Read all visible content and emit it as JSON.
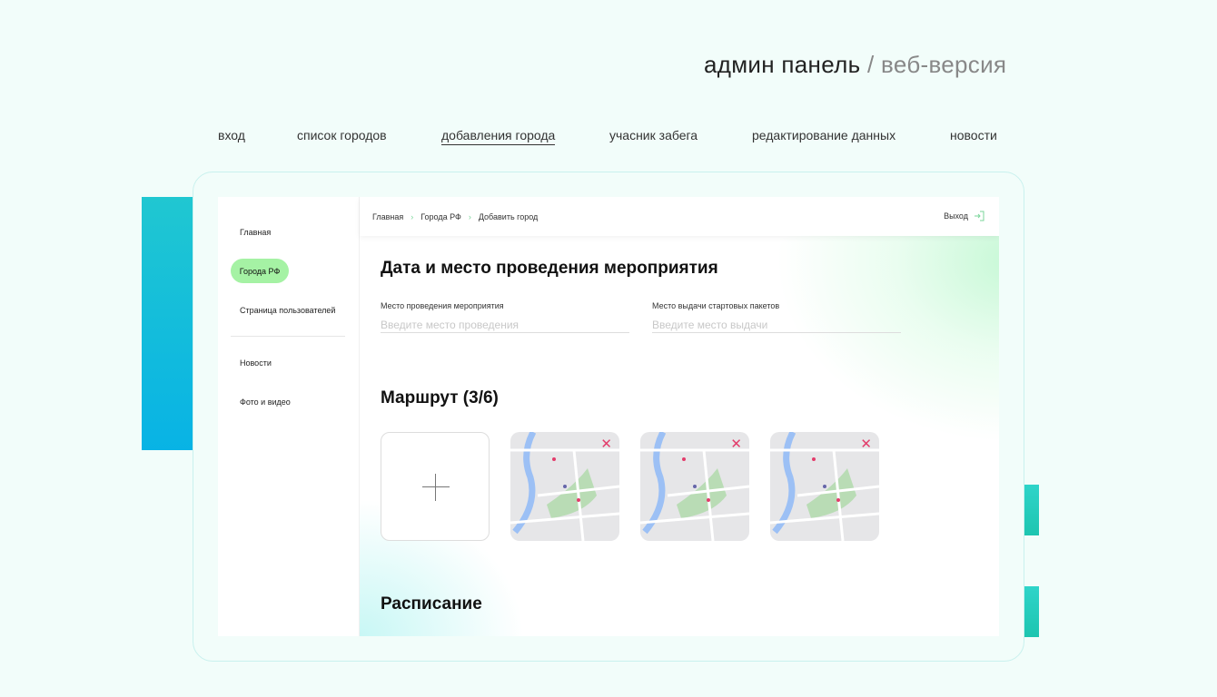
{
  "header": {
    "title": "админ панель",
    "separator": "/",
    "subtitle": "веб-версия"
  },
  "topnav": [
    {
      "label": "вход"
    },
    {
      "label": "список городов"
    },
    {
      "label": "добавления города",
      "active": true
    },
    {
      "label": "учасник забега"
    },
    {
      "label": "редактирование данных"
    },
    {
      "label": "новости"
    }
  ],
  "sidebar": {
    "items": [
      {
        "label": "Главная"
      },
      {
        "label": "Города РФ",
        "active": true
      },
      {
        "label": "Страница пользователей"
      },
      {
        "label": "Новости"
      },
      {
        "label": "Фото и видео"
      }
    ]
  },
  "breadcrumb": [
    "Главная",
    "Города РФ",
    "Добавить город"
  ],
  "breadcrumb_sep": "›",
  "exit_label": "Выход",
  "section1": {
    "title": "Дата и место проведения мероприятия",
    "fields": [
      {
        "label": "Место проведения мероприятия",
        "placeholder": "Введите место проведения",
        "value": ""
      },
      {
        "label": "Место выдачи стартовых пакетов",
        "placeholder": "Введите место выдачи",
        "value": ""
      }
    ]
  },
  "route": {
    "title": "Маршрут (3/6)",
    "remove_glyph": "✕"
  },
  "schedule": {
    "title": "Расписание"
  },
  "colors": {
    "accent": "#a5f2a4",
    "remove": "#e33c6b",
    "gradient_start": "#20c7d1",
    "gradient_end": "#08b3e5"
  }
}
